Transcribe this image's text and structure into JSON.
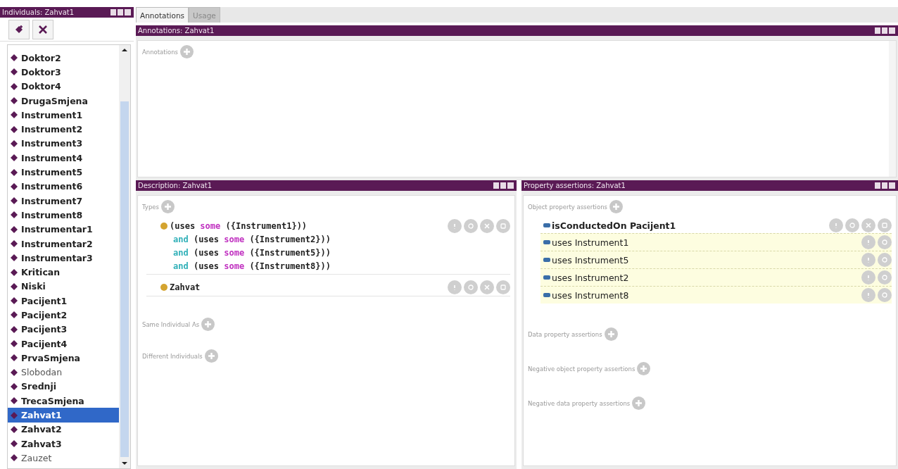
{
  "individuals": {
    "title": "Individuals: Zahvat1",
    "items": [
      {
        "label": "Doktor2",
        "inferred": false,
        "selected": false
      },
      {
        "label": "Doktor3",
        "inferred": false,
        "selected": false
      },
      {
        "label": "Doktor4",
        "inferred": false,
        "selected": false
      },
      {
        "label": "DrugaSmjena",
        "inferred": false,
        "selected": false
      },
      {
        "label": "Instrument1",
        "inferred": false,
        "selected": false
      },
      {
        "label": "Instrument2",
        "inferred": false,
        "selected": false
      },
      {
        "label": "Instrument3",
        "inferred": false,
        "selected": false
      },
      {
        "label": "Instrument4",
        "inferred": false,
        "selected": false
      },
      {
        "label": "Instrument5",
        "inferred": false,
        "selected": false
      },
      {
        "label": "Instrument6",
        "inferred": false,
        "selected": false
      },
      {
        "label": "Instrument7",
        "inferred": false,
        "selected": false
      },
      {
        "label": "Instrument8",
        "inferred": false,
        "selected": false
      },
      {
        "label": "Instrumentar1",
        "inferred": false,
        "selected": false
      },
      {
        "label": "Instrumentar2",
        "inferred": false,
        "selected": false
      },
      {
        "label": "Instrumentar3",
        "inferred": false,
        "selected": false
      },
      {
        "label": "Kritican",
        "inferred": false,
        "selected": false
      },
      {
        "label": "Niski",
        "inferred": false,
        "selected": false
      },
      {
        "label": "Pacijent1",
        "inferred": false,
        "selected": false
      },
      {
        "label": "Pacijent2",
        "inferred": false,
        "selected": false
      },
      {
        "label": "Pacijent3",
        "inferred": false,
        "selected": false
      },
      {
        "label": "Pacijent4",
        "inferred": false,
        "selected": false
      },
      {
        "label": "PrvaSmjena",
        "inferred": false,
        "selected": false
      },
      {
        "label": "Slobodan",
        "inferred": true,
        "selected": false
      },
      {
        "label": "Srednji",
        "inferred": false,
        "selected": false
      },
      {
        "label": "TrecaSmjena",
        "inferred": false,
        "selected": false
      },
      {
        "label": "Zahvat1",
        "inferred": false,
        "selected": true
      },
      {
        "label": "Zahvat2",
        "inferred": false,
        "selected": false
      },
      {
        "label": "Zahvat3",
        "inferred": false,
        "selected": false
      },
      {
        "label": "Zauzet",
        "inferred": true,
        "selected": false
      }
    ]
  },
  "tabs": [
    {
      "label": "Annotations",
      "selected": true
    },
    {
      "label": "Usage",
      "selected": false
    }
  ],
  "annotations": {
    "title": "Annotations: Zahvat1",
    "section": "Annotations"
  },
  "description": {
    "title": "Description: Zahvat1",
    "types_label": "Types",
    "types": [
      {
        "lines": [
          [
            {
              "kind": "plain",
              "text": "(uses "
            },
            {
              "kind": "keyword",
              "text": "some"
            },
            {
              "kind": "plain",
              "text": " ({Instrument1}))"
            }
          ],
          [
            {
              "kind": "connective",
              "text": "and"
            },
            {
              "kind": "plain",
              "text": " (uses "
            },
            {
              "kind": "keyword",
              "text": "some"
            },
            {
              "kind": "plain",
              "text": " ({Instrument2}))"
            }
          ],
          [
            {
              "kind": "connective",
              "text": "and"
            },
            {
              "kind": "plain",
              "text": " (uses "
            },
            {
              "kind": "keyword",
              "text": "some"
            },
            {
              "kind": "plain",
              "text": " ({Instrument5}))"
            }
          ],
          [
            {
              "kind": "connective",
              "text": "and"
            },
            {
              "kind": "plain",
              "text": " (uses "
            },
            {
              "kind": "keyword",
              "text": "some"
            },
            {
              "kind": "plain",
              "text": " ({Instrument8}))"
            }
          ]
        ]
      },
      {
        "lines": [
          [
            {
              "kind": "plain",
              "text": "Zahvat"
            }
          ]
        ]
      }
    ],
    "sections": [
      "Same Individual As",
      "Different Individuals"
    ]
  },
  "properties": {
    "title": "Property assertions: Zahvat1",
    "object_label": "Object property assertions",
    "assertions": [
      {
        "property": "isConductedOn",
        "value": "Pacijent1",
        "inferred": false
      },
      {
        "property": "uses",
        "value": "Instrument1",
        "inferred": true
      },
      {
        "property": "uses",
        "value": "Instrument5",
        "inferred": true
      },
      {
        "property": "uses",
        "value": "Instrument2",
        "inferred": true
      },
      {
        "property": "uses",
        "value": "Instrument8",
        "inferred": true
      }
    ],
    "sections": [
      "Data property assertions",
      "Negative object property assertions",
      "Negative data property assertions"
    ]
  }
}
